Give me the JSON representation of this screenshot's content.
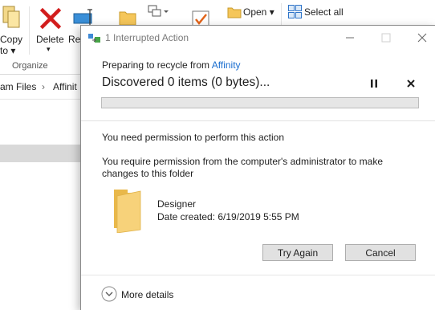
{
  "explorer": {
    "ribbon": {
      "copy_label": "Copy",
      "copy_to_label": "to",
      "delete_label": "Delete",
      "rename_partial": "Re",
      "open_label": "Open",
      "select_all_label": "Select all",
      "organize_group": "Organize"
    },
    "address": {
      "path_part1": "am Files",
      "path_sep": "›",
      "path_part2": "Affinit"
    }
  },
  "dialog": {
    "title": "1 Interrupted Action",
    "preparing_prefix": "Preparing to recycle from ",
    "preparing_source": "Affinity",
    "discovered": "Discovered 0 items (0 bytes)...",
    "progress_percent": 0,
    "permission_heading": "You need permission to perform this action",
    "permission_body": "You require permission from the computer's administrator to make changes to this folder",
    "file": {
      "name": "Designer",
      "date_created": "Date created: 6/19/2019 5:55 PM"
    },
    "buttons": {
      "try_again": "Try Again",
      "cancel": "Cancel"
    },
    "more_details": "More details"
  },
  "colors": {
    "link": "#1a6ecf",
    "folder": "#f5c65a",
    "button_bg": "#e1e1e1"
  }
}
